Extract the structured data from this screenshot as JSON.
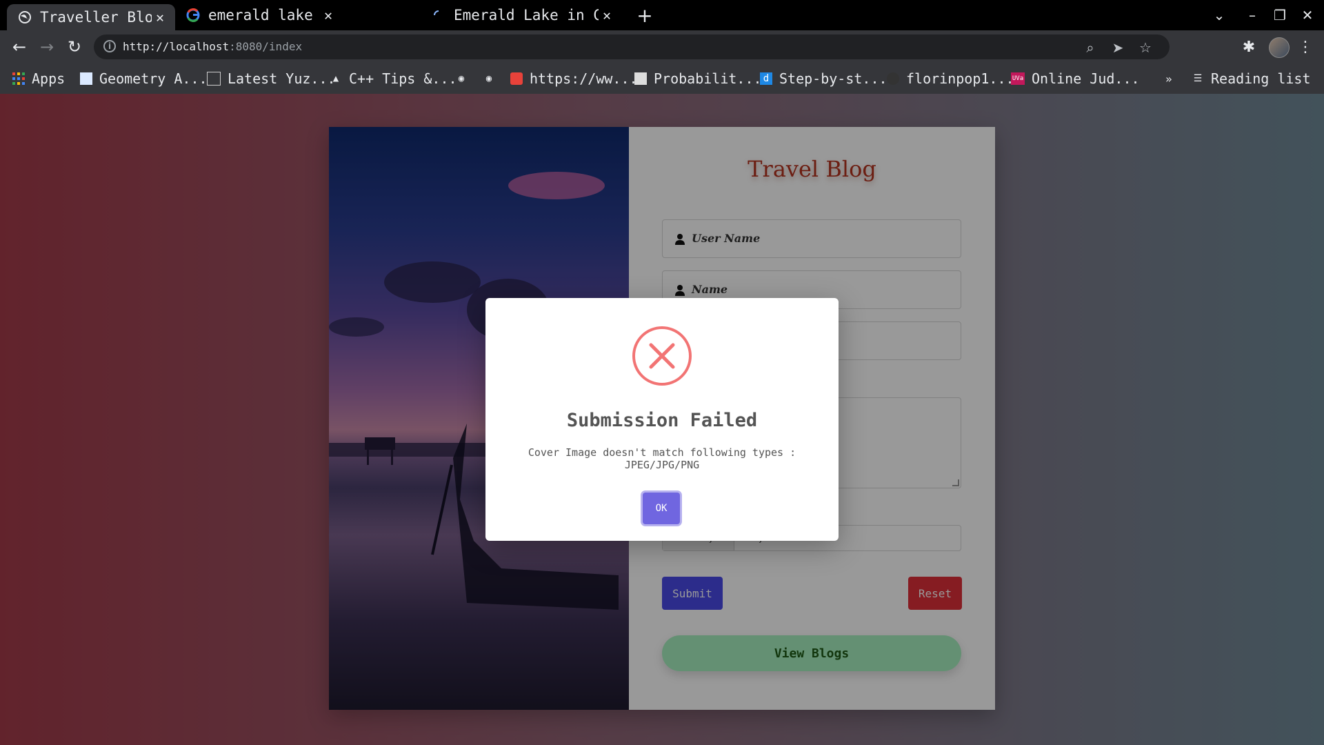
{
  "browser": {
    "tabs": [
      {
        "title": "Traveller Blog",
        "active": true
      },
      {
        "title": "emerald lake yoho",
        "active": false
      },
      {
        "title": "Emerald Lake in Car",
        "active": false
      }
    ],
    "new_tab": "+",
    "url_host": "http://localhost",
    "url_rest": ":8080/index",
    "bookmarks": [
      {
        "label": "Apps"
      },
      {
        "label": "Geometry A..."
      },
      {
        "label": "Latest Yuz..."
      },
      {
        "label": "C++ Tips &..."
      },
      {
        "label": "https://ww..."
      },
      {
        "label": "Probabilit..."
      },
      {
        "label": "Step-by-st..."
      },
      {
        "label": "florinpop1..."
      },
      {
        "label": "Online Jud..."
      }
    ],
    "overflow": "»",
    "reading_list": "Reading list"
  },
  "page": {
    "title": "Travel Blog",
    "fields": {
      "username_placeholder": "User Name",
      "name_placeholder": "Name"
    },
    "file": {
      "choose_label": "Choose file",
      "status": "No file chosen"
    },
    "submit_label": "Submit",
    "reset_label": "Reset",
    "view_blogs_label": "View Blogs"
  },
  "modal": {
    "title": "Submission Failed",
    "message": "Cover Image doesn't match following types : JPEG/JPG/PNG",
    "ok_label": "OK",
    "icon": "error-x-circle",
    "accent": "#f27474",
    "button_color": "#7066e0"
  }
}
